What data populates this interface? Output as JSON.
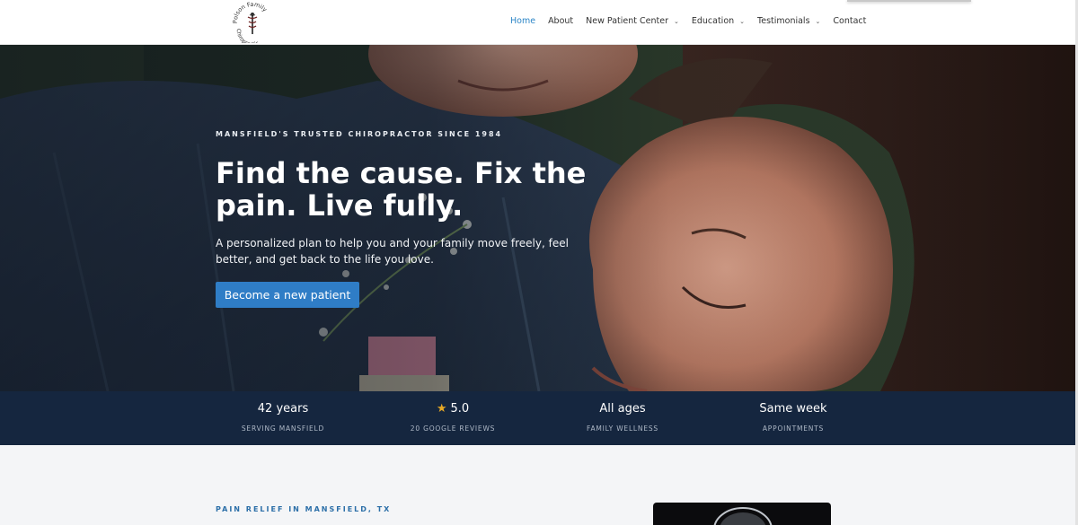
{
  "header": {
    "logo_text_top": "Polson Family",
    "logo_text_bottom": "Chiropractic",
    "nav": [
      {
        "label": "Home",
        "active": true,
        "dropdown": false
      },
      {
        "label": "About",
        "active": false,
        "dropdown": false
      },
      {
        "label": "New Patient Center",
        "active": false,
        "dropdown": true
      },
      {
        "label": "Education",
        "active": false,
        "dropdown": true
      },
      {
        "label": "Testimonials",
        "active": false,
        "dropdown": true
      },
      {
        "label": "Contact",
        "active": false,
        "dropdown": false
      }
    ]
  },
  "hero": {
    "eyebrow": "MANSFIELD'S TRUSTED CHIROPRACTOR SINCE 1984",
    "headline": "Find the cause. Fix the pain. Live fully.",
    "subtext": "A personalized plan to help you and your family move freely, feel better, and get back to the life you love.",
    "cta_label": "Become a new patient"
  },
  "stats": [
    {
      "value": "42 years",
      "label": "SERVING MANSFIELD",
      "icon": ""
    },
    {
      "value": "5.0",
      "label": "20 GOOGLE REVIEWS",
      "icon": "star-icon"
    },
    {
      "value": "All ages",
      "label": "FAMILY WELLNESS",
      "icon": ""
    },
    {
      "value": "Same week",
      "label": "APPOINTMENTS",
      "icon": ""
    }
  ],
  "lower": {
    "eyebrow": "PAIN RELIEF IN MANSFIELD, TX"
  },
  "colors": {
    "accent": "#2f7dc6",
    "nav_active": "#2c86c7",
    "stats_bg": "#15263f",
    "star": "#e6a825"
  }
}
